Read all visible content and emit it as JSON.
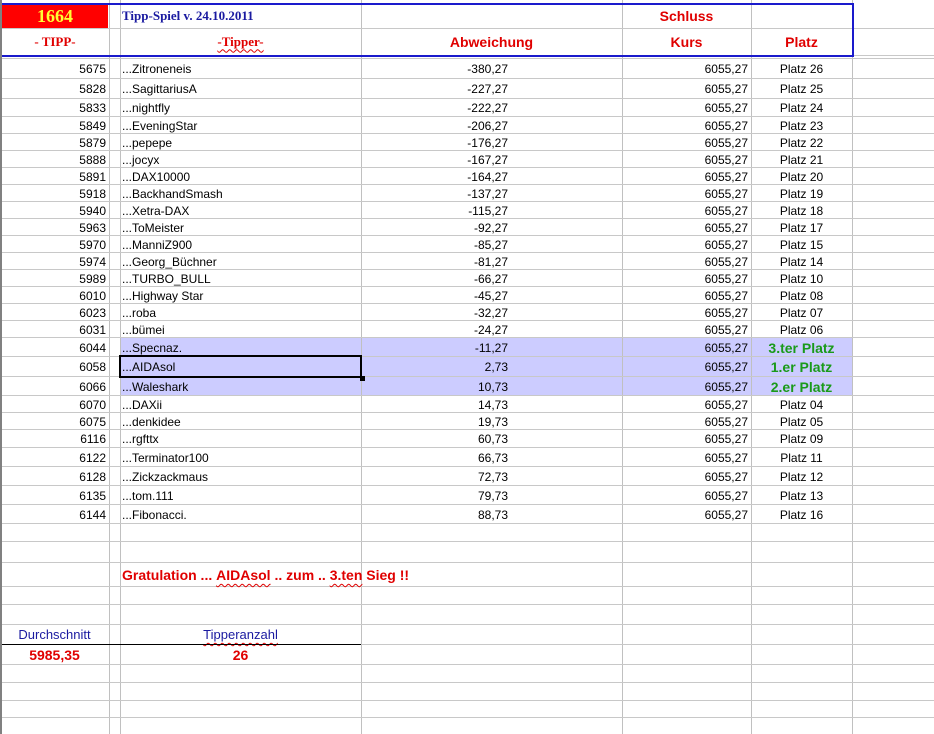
{
  "header": {
    "tipp_count": "1664",
    "title": "Tipp-Spiel v. 24.10.2011",
    "schluss": "Schluss",
    "col_tipp": "- TIPP-",
    "col_tipper": "-Tipper-",
    "col_abweichung": "Abweichung",
    "col_kurs": "Kurs",
    "col_platz": "Platz"
  },
  "rows": [
    {
      "tipp": "5675",
      "tipper": "...Zitroneneis",
      "abw": "-380,27",
      "kurs": "6055,27",
      "platz": "Platz 26"
    },
    {
      "tipp": "5828",
      "tipper": "...SagittariusA",
      "abw": "-227,27",
      "kurs": "6055,27",
      "platz": "Platz 25"
    },
    {
      "tipp": "5833",
      "tipper": "...nightfly",
      "abw": "-222,27",
      "kurs": "6055,27",
      "platz": "Platz 24"
    },
    {
      "tipp": "5849",
      "tipper": "...EveningStar",
      "abw": "-206,27",
      "kurs": "6055,27",
      "platz": "Platz 23"
    },
    {
      "tipp": "5879",
      "tipper": "...pepepe",
      "abw": "-176,27",
      "kurs": "6055,27",
      "platz": "Platz 22"
    },
    {
      "tipp": "5888",
      "tipper": "...jocyx",
      "abw": "-167,27",
      "kurs": "6055,27",
      "platz": "Platz 21"
    },
    {
      "tipp": "5891",
      "tipper": "...DAX10000",
      "abw": "-164,27",
      "kurs": "6055,27",
      "platz": "Platz 20"
    },
    {
      "tipp": "5918",
      "tipper": "...BackhandSmash",
      "abw": "-137,27",
      "kurs": "6055,27",
      "platz": "Platz 19"
    },
    {
      "tipp": "5940",
      "tipper": "...Xetra-DAX",
      "abw": "-115,27",
      "kurs": "6055,27",
      "platz": "Platz 18"
    },
    {
      "tipp": "5963",
      "tipper": "...ToMeister",
      "abw": "-92,27",
      "kurs": "6055,27",
      "platz": "Platz 17"
    },
    {
      "tipp": "5970",
      "tipper": "...ManniZ900",
      "abw": "-85,27",
      "kurs": "6055,27",
      "platz": "Platz 15"
    },
    {
      "tipp": "5974",
      "tipper": "...Georg_Büchner",
      "abw": "-81,27",
      "kurs": "6055,27",
      "platz": "Platz 14"
    },
    {
      "tipp": "5989",
      "tipper": "...TURBO_BULL",
      "abw": "-66,27",
      "kurs": "6055,27",
      "platz": "Platz 10"
    },
    {
      "tipp": "6010",
      "tipper": "...Highway Star",
      "abw": "-45,27",
      "kurs": "6055,27",
      "platz": "Platz 08"
    },
    {
      "tipp": "6023",
      "tipper": "...roba",
      "abw": "-32,27",
      "kurs": "6055,27",
      "platz": "Platz 07"
    },
    {
      "tipp": "6031",
      "tipper": "...bümei",
      "abw": "-24,27",
      "kurs": "6055,27",
      "platz": "Platz 06"
    },
    {
      "tipp": "6044",
      "tipper": "...Specnaz.",
      "abw": "-11,27",
      "kurs": "6055,27",
      "platz": "3.ter Platz",
      "winner": true
    },
    {
      "tipp": "6058",
      "tipper": "...AIDAsol",
      "abw": "2,73",
      "kurs": "6055,27",
      "platz": "1.er Platz",
      "winner": true,
      "selected": true
    },
    {
      "tipp": "6066",
      "tipper": "...Waleshark",
      "abw": "10,73",
      "kurs": "6055,27",
      "platz": "2.er Platz",
      "winner": true
    },
    {
      "tipp": "6070",
      "tipper": "...DAXii",
      "abw": "14,73",
      "kurs": "6055,27",
      "platz": "Platz 04"
    },
    {
      "tipp": "6075",
      "tipper": "...denkidee",
      "abw": "19,73",
      "kurs": "6055,27",
      "platz": "Platz 05"
    },
    {
      "tipp": "6116",
      "tipper": "...rgfttx",
      "abw": "60,73",
      "kurs": "6055,27",
      "platz": "Platz 09"
    },
    {
      "tipp": "6122",
      "tipper": "...Terminator100",
      "abw": "66,73",
      "kurs": "6055,27",
      "platz": "Platz 11"
    },
    {
      "tipp": "6128",
      "tipper": "...Zickzackmaus",
      "abw": "72,73",
      "kurs": "6055,27",
      "platz": "Platz 12"
    },
    {
      "tipp": "6135",
      "tipper": "...tom.111",
      "abw": "79,73",
      "kurs": "6055,27",
      "platz": "Platz 13"
    },
    {
      "tipp": "6144",
      "tipper": "...Fibonacci.",
      "abw": "88,73",
      "kurs": "6055,27",
      "platz": "Platz 16"
    }
  ],
  "footer": {
    "gratulation_pre": "Gratulation ... ",
    "gratulation_name": "AIDAsol",
    "gratulation_mid": " .. zum .. ",
    "gratulation_sieg": "3.ten",
    "gratulation_post": " Sieg !!",
    "durchschnitt_label": "Durchschnitt",
    "durchschnitt_value": "5985,35",
    "tipperanzahl_label": "Tipperanzahl",
    "tipperanzahl_value": "26"
  },
  "colors": {
    "highlight": "#ccccff",
    "red": "#e00000",
    "green": "#1a9a1a",
    "blue": "#0000c0"
  }
}
